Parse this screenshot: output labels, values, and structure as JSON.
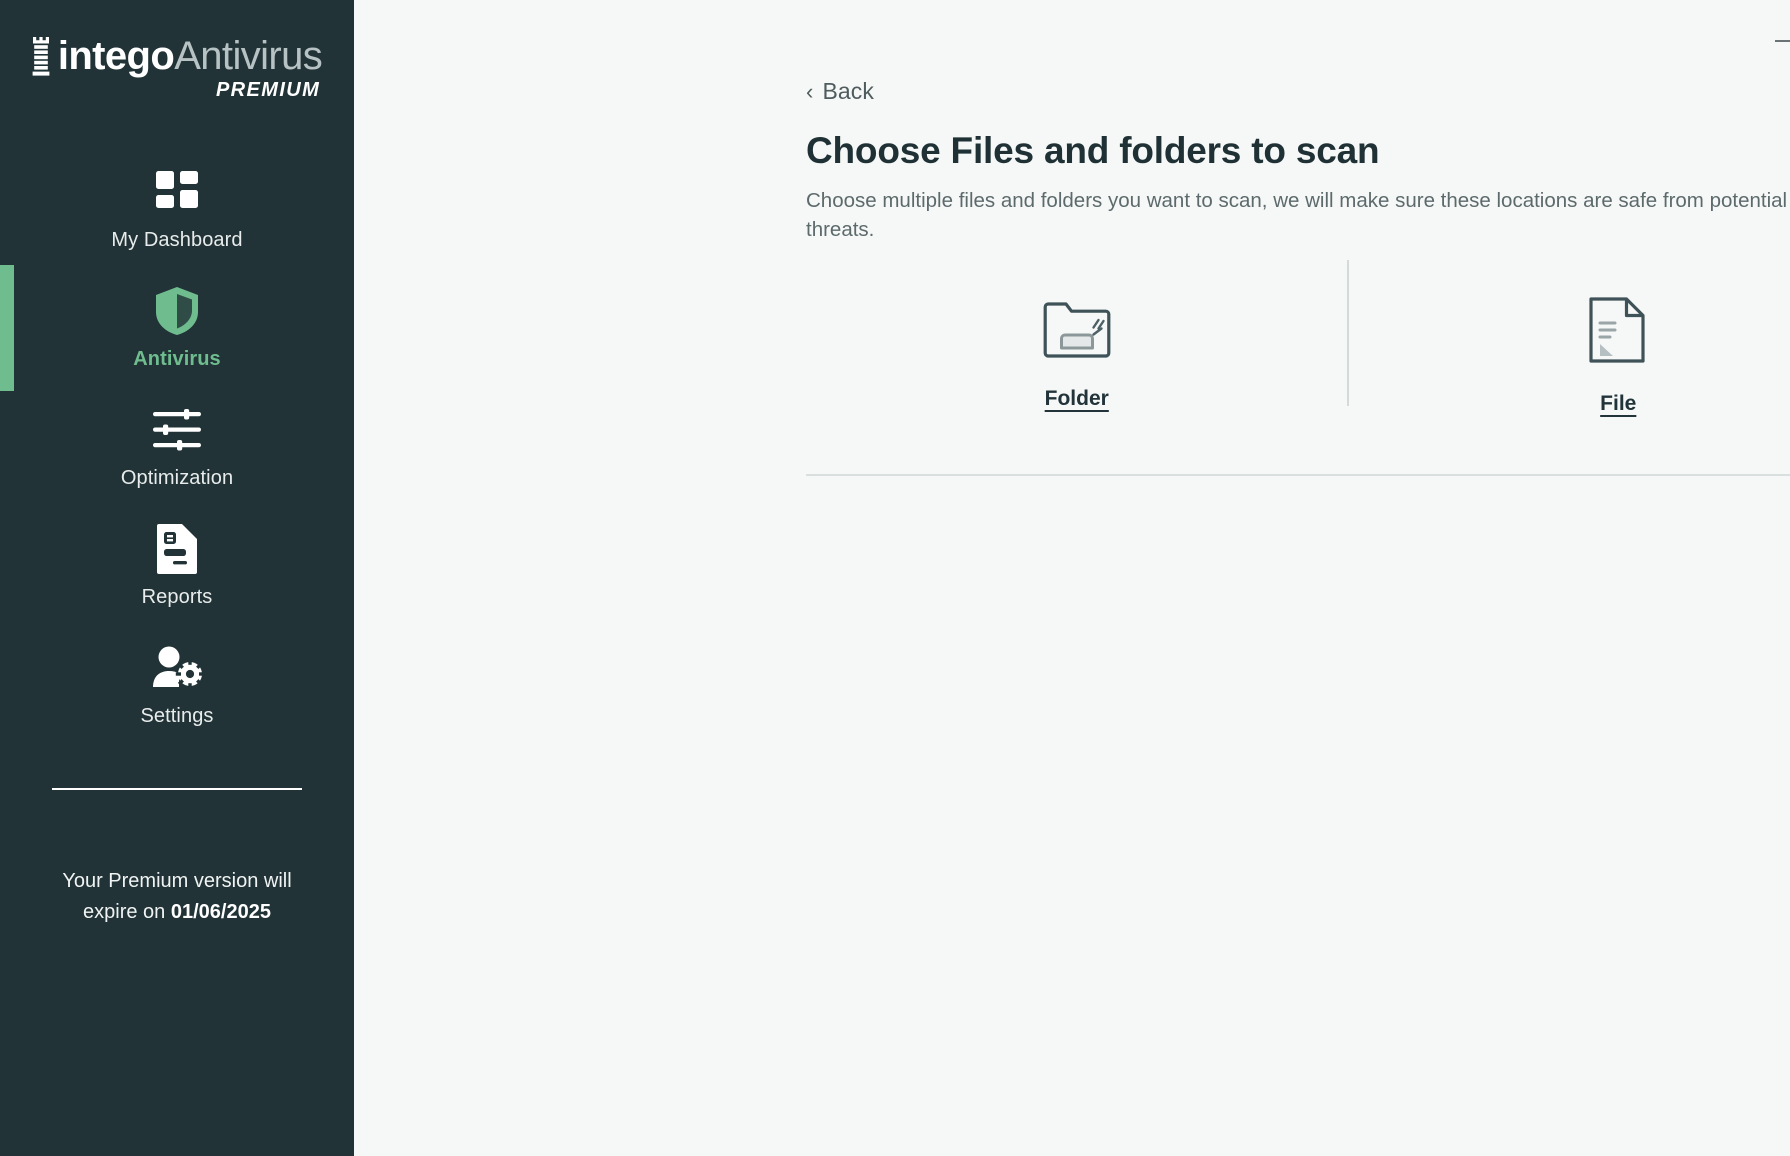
{
  "brand": {
    "name_bold": "intego",
    "name_light": "Antivirus",
    "tier": "PREMIUM",
    "logo_icon": "rook-tower-icon",
    "accent_color": "#6fbd8f",
    "sidebar_color": "#213336"
  },
  "sidebar": {
    "items": [
      {
        "label": "My Dashboard",
        "icon": "grid-squares-icon",
        "active": false
      },
      {
        "label": "Antivirus",
        "icon": "shield-icon",
        "active": true
      },
      {
        "label": "Optimization",
        "icon": "sliders-icon",
        "active": false
      },
      {
        "label": "Reports",
        "icon": "document-report-icon",
        "active": false
      },
      {
        "label": "Settings",
        "icon": "user-gear-icon",
        "active": false
      }
    ],
    "footer": {
      "text_before": "Your Premium version will expire on ",
      "expiry_date": "01/06/2025"
    }
  },
  "window_controls": {
    "minimize_label": "—",
    "minimize_icon": "minimize-icon",
    "close_label": "✕",
    "close_icon": "close-icon"
  },
  "main": {
    "back": {
      "label": "Back",
      "icon": "chevron-left-icon"
    },
    "title": "Choose Files and folders to scan",
    "subtitle": "Choose multiple files and folders you want to scan, we will make sure these locations are safe from potential threats.",
    "choices": [
      {
        "label": "Folder",
        "icon": "folder-icon"
      },
      {
        "label": "File",
        "icon": "file-document-icon"
      }
    ]
  }
}
